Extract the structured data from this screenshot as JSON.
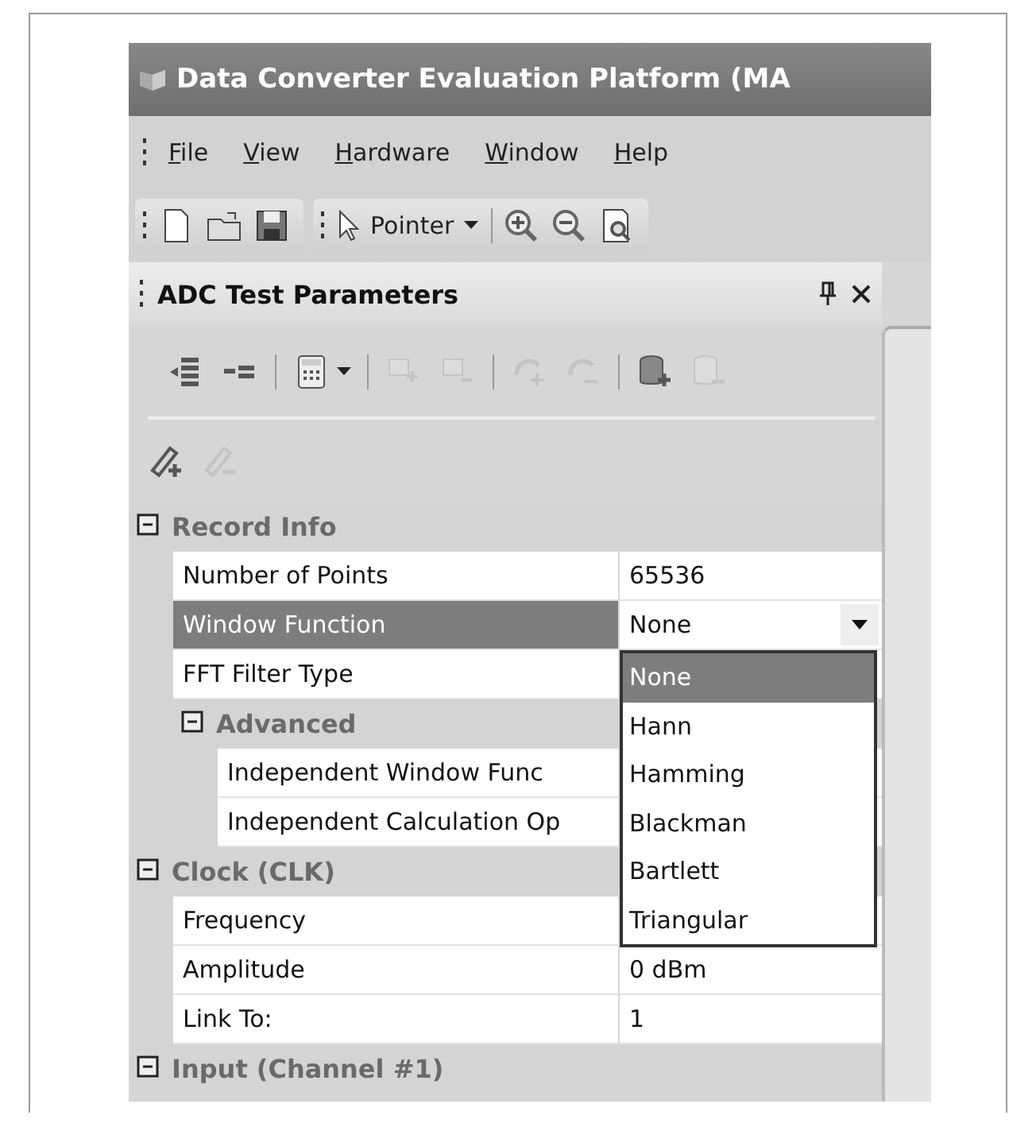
{
  "window": {
    "title": "Data Converter Evaluation Platform (MA"
  },
  "menu": [
    {
      "label": "File"
    },
    {
      "label": "View"
    },
    {
      "label": "Hardware"
    },
    {
      "label": "Window"
    },
    {
      "label": "Help"
    }
  ],
  "toolbar": {
    "tools": [
      {
        "kind": "new"
      },
      {
        "kind": "open"
      },
      {
        "kind": "save"
      },
      {
        "kind": "pointer",
        "label": "Pointer"
      },
      {
        "kind": "zoom-in"
      },
      {
        "kind": "zoom-out"
      },
      {
        "kind": "zoom-fit"
      }
    ]
  },
  "panel": {
    "title": "ADC Test Parameters",
    "tools": [
      {
        "kind": "insert-row",
        "disabled": false
      },
      {
        "kind": "remove-row",
        "disabled": false
      },
      {
        "kind": "calculator",
        "disabled": false
      },
      {
        "kind": "move-right",
        "disabled": true
      },
      {
        "kind": "move-left",
        "disabled": true
      },
      {
        "kind": "undo",
        "disabled": true
      },
      {
        "kind": "redo",
        "disabled": true
      },
      {
        "kind": "db-add",
        "disabled": false
      },
      {
        "kind": "db-remove",
        "disabled": true
      },
      {
        "kind": "pen-add",
        "disabled": false
      },
      {
        "kind": "pen-remove",
        "disabled": true
      }
    ],
    "properties": [
      {
        "kind": "category",
        "name": "Record Info",
        "expanded": true,
        "children": [
          {
            "kind": "property",
            "name": "Number of Points",
            "value": "65536",
            "selected": false
          },
          {
            "kind": "property",
            "name": "Window Function",
            "value": "None",
            "selected": true,
            "dropdown": {
              "open": true,
              "options": [
                {
                  "label": "None",
                  "selected": true
                },
                {
                  "label": "Hann",
                  "selected": false
                },
                {
                  "label": "Hamming",
                  "selected": false
                },
                {
                  "label": "Blackman",
                  "selected": false
                },
                {
                  "label": "Bartlett",
                  "selected": false
                },
                {
                  "label": "Triangular",
                  "selected": false
                }
              ]
            }
          },
          {
            "kind": "property",
            "name": "FFT Filter Type",
            "selected": false
          },
          {
            "kind": "category",
            "name": "Advanced",
            "expanded": true,
            "children": [
              {
                "kind": "property",
                "name": "Independent Window Func",
                "selected": false
              },
              {
                "kind": "property",
                "name": "Independent Calculation Op",
                "selected": false
              }
            ]
          }
        ]
      },
      {
        "kind": "category",
        "name": "Clock (CLK)",
        "expanded": true,
        "children": [
          {
            "kind": "property",
            "name": "Frequency",
            "selected": false
          },
          {
            "kind": "property",
            "name": "Amplitude",
            "value": "0 dBm",
            "selected": false
          },
          {
            "kind": "property",
            "name": "Link To:",
            "value": "1",
            "selected": false
          }
        ]
      },
      {
        "kind": "category",
        "name": "Input (Channel #1)",
        "expanded": true
      }
    ]
  }
}
